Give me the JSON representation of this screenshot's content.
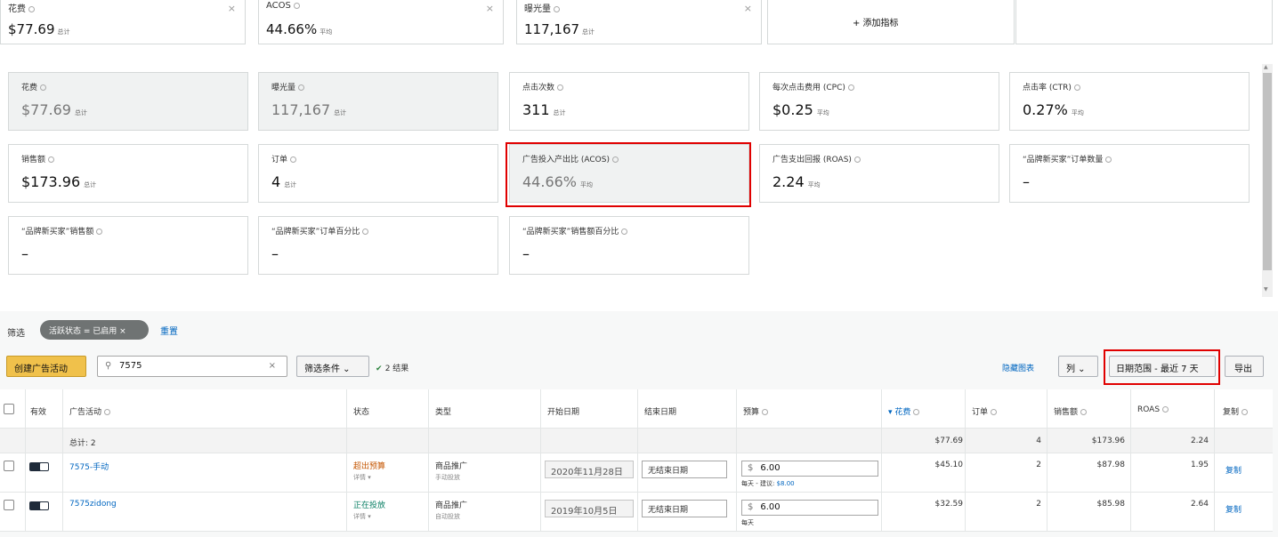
{
  "top_metrics": [
    {
      "label": "花费",
      "value": "$77.69",
      "unit": "总计"
    },
    {
      "label": "ACOS",
      "value": "44.66%",
      "unit": "平均"
    },
    {
      "label": "曝光量",
      "value": "117,167",
      "unit": "总计"
    }
  ],
  "add_metric_label": "+ 添加指标",
  "metrics": [
    {
      "label": "花费",
      "value": "$77.69",
      "unit": "总计"
    },
    {
      "label": "曝光量",
      "value": "117,167",
      "unit": "总计"
    },
    {
      "label": "点击次数",
      "value": "311",
      "unit": "总计"
    },
    {
      "label": "每次点击费用 (CPC)",
      "value": "$0.25",
      "unit": "平均"
    },
    {
      "label": "点击率 (CTR)",
      "value": "0.27%",
      "unit": "平均"
    },
    {
      "label": "销售额",
      "value": "$173.96",
      "unit": "总计"
    },
    {
      "label": "订单",
      "value": "4",
      "unit": "总计"
    },
    {
      "label": "广告投入产出比 (ACOS)",
      "value": "44.66%",
      "unit": "平均"
    },
    {
      "label": "广告支出回报 (ROAS)",
      "value": "2.24",
      "unit": "平均"
    },
    {
      "label": "“品牌新买家”订单数量",
      "value": "–",
      "unit": ""
    },
    {
      "label": "“品牌新买家”销售额",
      "value": "–",
      "unit": ""
    },
    {
      "label": "“品牌新买家”订单百分比",
      "value": "–",
      "unit": ""
    },
    {
      "label": "“品牌新买家”销售额百分比",
      "value": "–",
      "unit": ""
    }
  ],
  "filter": {
    "label": "筛选",
    "chip": "活跃状态 = 已启用 ×",
    "reset": "重置"
  },
  "toolbar": {
    "create": "创建广告活动",
    "search_value": "7575",
    "filter_btn": "筛选条件 ⌄",
    "results": "2 结果",
    "hide_chart": "隐藏图表",
    "columns": "列 ⌄",
    "date_range": "日期范围 - 最近 7 天",
    "export": "导出"
  },
  "table": {
    "headers": {
      "active": "有效",
      "campaign": "广告活动",
      "status": "状态",
      "type": "类型",
      "start": "开始日期",
      "end": "结束日期",
      "budget": "预算",
      "spend": "▾ 花费",
      "orders": "订单",
      "sales": "销售额",
      "roas": "ROAS",
      "copy": "复制"
    },
    "total": {
      "label": "总计: 2",
      "spend": "$77.69",
      "orders": "4",
      "sales": "$173.96",
      "roas": "2.24"
    },
    "rows": [
      {
        "campaign": "7575-手动",
        "status": "超出预算",
        "status_sub": "详情 ▾",
        "type": "商品推广",
        "type_sub": "手动投放",
        "start": "2020年11月28日",
        "end": "无结束日期",
        "budget_currency": "$",
        "budget": "6.00",
        "budget_note": "每天 - 建议: ",
        "budget_suggest": "$8.00",
        "spend": "$45.10",
        "orders": "2",
        "sales": "$87.98",
        "roas": "1.95",
        "copy": "复制"
      },
      {
        "campaign": "7575zidong",
        "status": "正在投放",
        "status_sub": "详情 ▾",
        "type": "商品推广",
        "type_sub": "自动投放",
        "start": "2019年10月5日",
        "end": "无结束日期",
        "budget_currency": "$",
        "budget": "6.00",
        "budget_note": "每天",
        "budget_suggest": "",
        "spend": "$32.59",
        "orders": "2",
        "sales": "$85.98",
        "roas": "2.64",
        "copy": "复制"
      }
    ]
  },
  "colors": {
    "highlight": "#e00000",
    "link": "#0066c0",
    "button_primary": "#f0c14b"
  }
}
